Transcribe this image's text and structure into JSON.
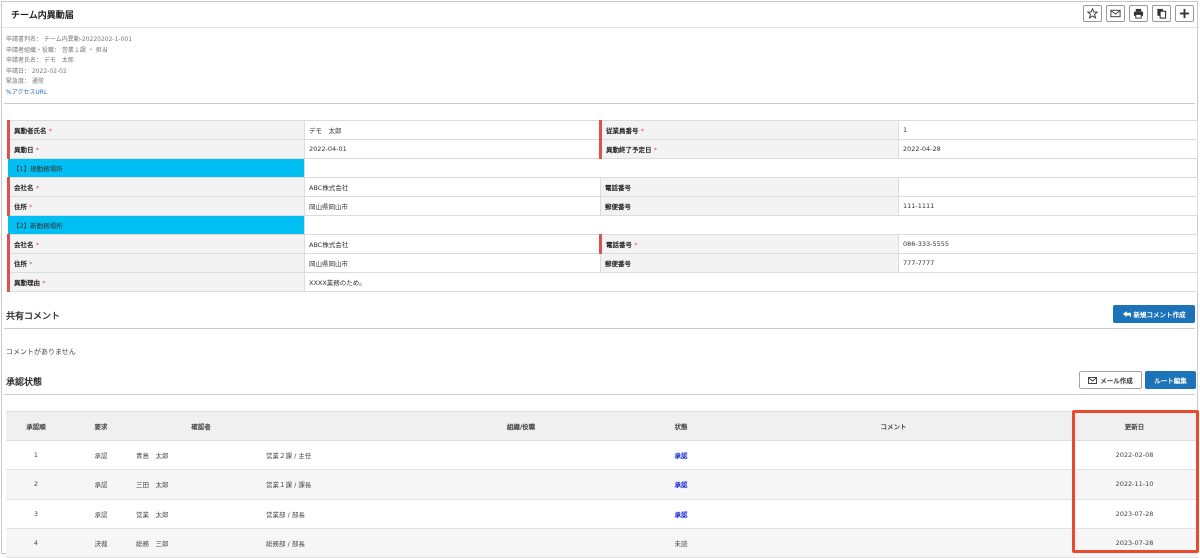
{
  "header": {
    "title": "チーム内異動届",
    "toolbar": [
      "star-icon",
      "mail-icon",
      "print-icon",
      "copy-icon",
      "plus-icon"
    ]
  },
  "meta": {
    "rows": [
      "申請書列名： チーム内異動-20220202-1-001",
      "申請者組織・役職： 営業１課 ・ 担当",
      "申請者氏名： デモ　太郎",
      "申請日： 2022-02-02",
      "緊急度： 通常"
    ],
    "access_url": "アクセスURL"
  },
  "form": {
    "applicant_label": "異動者氏名",
    "applicant_value": "デモ　太郎",
    "employee_no_label": "従業員番号",
    "employee_no_value": "1",
    "move_date_label": "異動日",
    "move_date_value": "2022-04-01",
    "end_date_label": "異動終了予定日",
    "end_date_value": "2022-04-28",
    "current_section": "【1】現勤務場所",
    "new_section": "【2】新勤務場所",
    "company_label": "会社名",
    "phone_label": "電話番号",
    "address_label": "住所",
    "postal_label": "郵便番号",
    "cur_company": "ABC株式会社",
    "cur_phone": "",
    "cur_address": "岡山県岡山市",
    "cur_postal": "111-1111",
    "new_company": "ABC株式会社",
    "new_phone": "086-333-5555",
    "new_address": "岡山県岡山市",
    "new_postal": "777-7777",
    "reason_label": "異動理由",
    "reason_value": "XXXX業務のため。",
    "required_mark": "*"
  },
  "comments": {
    "title": "共有コメント",
    "new_button": "新規コメント作成",
    "empty": "コメントがありません"
  },
  "approval": {
    "title": "承認状態",
    "mail_button": "メール作成",
    "route_button": "ルート編集",
    "headers": [
      "承認順",
      "要求",
      "確認者",
      "",
      "組織/役職",
      "状態",
      "コメント",
      "更新日"
    ],
    "rows": [
      {
        "order": "1",
        "request": "承認",
        "name": "青島　太郎",
        "org": "営業２課 / 主任",
        "status": "承認",
        "comment": "",
        "date": "2022-02-08"
      },
      {
        "order": "2",
        "request": "承認",
        "name": "三田　太郎",
        "org": "営業１課 / 課長",
        "status": "承認",
        "comment": "",
        "date": "2022-11-10"
      },
      {
        "order": "3",
        "request": "承認",
        "name": "営業　太郎",
        "org": "営業部 / 部長",
        "status": "承認",
        "comment": "",
        "date": "2023-07-28"
      },
      {
        "order": "4",
        "request": "決裁",
        "name": "総務　三郎",
        "org": "総務部 / 部長",
        "status": "未読",
        "comment": "",
        "date": "2023-07-28"
      }
    ]
  },
  "colors": {
    "section_bg": "#00bff3",
    "required": "#d9534f",
    "primary_button": "#1c73b8",
    "approved_text": "#1a2bd6",
    "highlight": "#e8492f"
  }
}
